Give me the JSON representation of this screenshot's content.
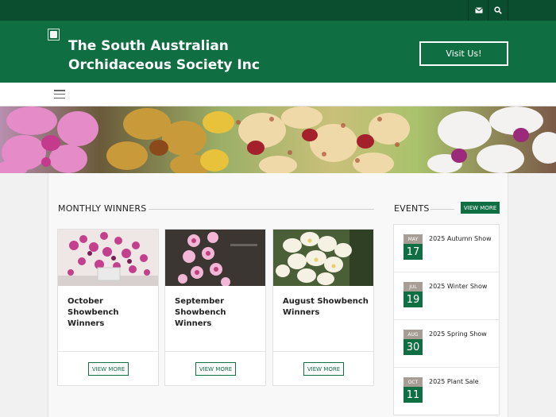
{
  "site": {
    "title_line1": "The South Australian",
    "title_line2": "Orchidaceous Society Inc",
    "visit_label": "Visit Us!"
  },
  "topbar": {
    "icons": [
      "mail-icon",
      "search-icon"
    ]
  },
  "colors": {
    "dark_green": "#0b4d2f",
    "brand_green": "#0f6e42",
    "month_badge": "#a69e94"
  },
  "winners": {
    "heading": "MONTHLY WINNERS",
    "cards": [
      {
        "title": "October Showbench Winners",
        "button": "VIEW MORE"
      },
      {
        "title": "September Showbench Winners",
        "button": "VIEW MORE"
      },
      {
        "title": "August Showbench Winners",
        "button": "VIEW MORE"
      }
    ]
  },
  "events": {
    "heading": "EVENTS",
    "view_more": "VIEW MORE",
    "items": [
      {
        "month": "MAY",
        "day": "17",
        "name": "2025 Autumn Show"
      },
      {
        "month": "JUL",
        "day": "19",
        "name": "2025 Winter Show"
      },
      {
        "month": "AUG",
        "day": "30",
        "name": "2025 Spring Show"
      },
      {
        "month": "OCT",
        "day": "11",
        "name": "2025 Plant Sale"
      }
    ]
  }
}
